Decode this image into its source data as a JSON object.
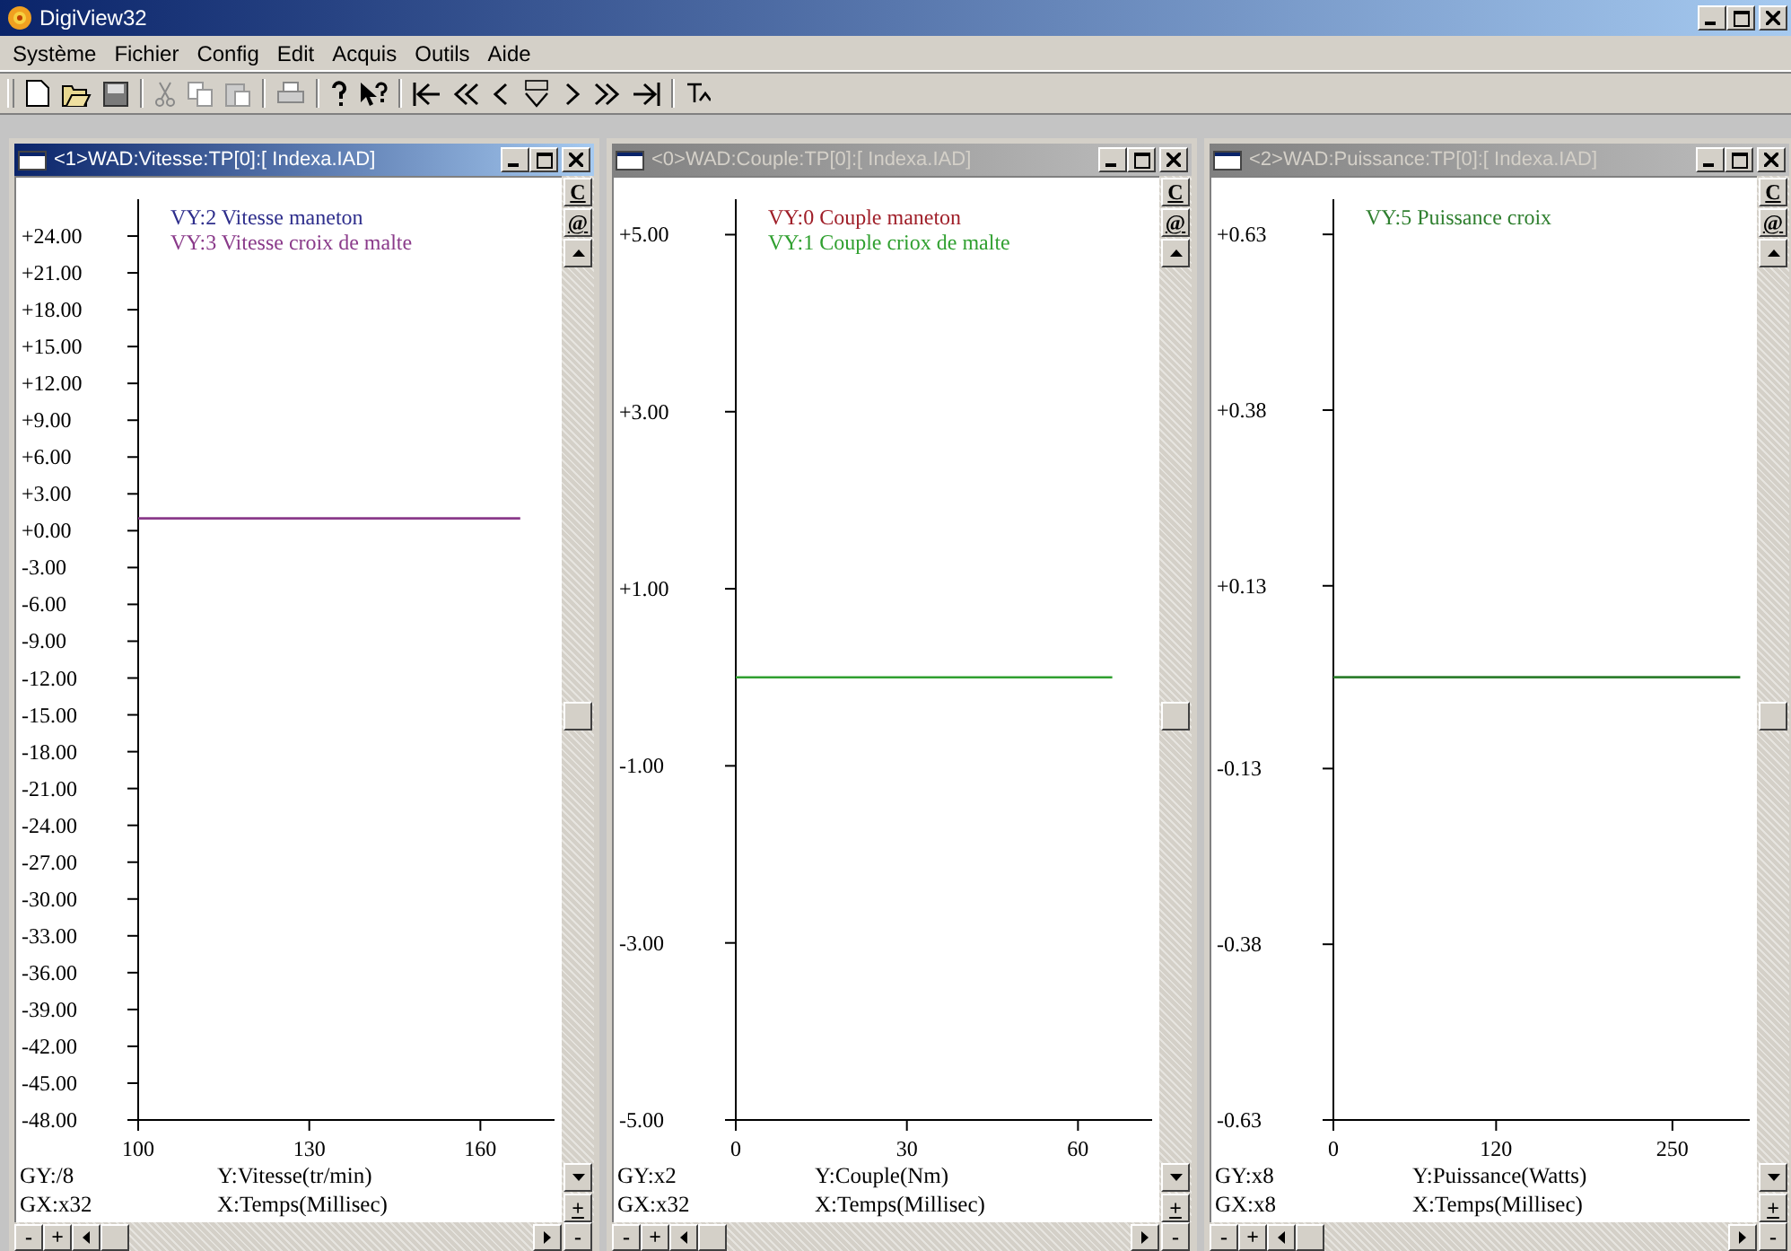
{
  "app": {
    "title": "DigiView32"
  },
  "menu": [
    "Système",
    "Fichier",
    "Config",
    "Edit",
    "Acquis",
    "Outils",
    "Aide"
  ],
  "windows": [
    {
      "title": "<1>WAD:Vitesse:TP[0]:[ Indexa.IAD]",
      "active": true,
      "side_buttons": [
        "C",
        "@"
      ],
      "zoom_v": [
        "+",
        "-"
      ],
      "zoom_h": [
        "-",
        "+"
      ],
      "gy": "GY:/8",
      "gx": "GX:x32",
      "chart_data": {
        "type": "line",
        "xlabel": "X:Temps(Millisec)",
        "ylabel": "Y:Vitesse(tr/min)",
        "x": [
          100,
          167
        ],
        "xlim": [
          100,
          173
        ],
        "ylim": [
          -48,
          27
        ],
        "xticks": [
          {
            "value": 100,
            "label": "100"
          },
          {
            "value": 130,
            "label": "130"
          },
          {
            "value": 160,
            "label": "160"
          }
        ],
        "yticks": [
          {
            "value": 24,
            "label": "+24.00"
          },
          {
            "value": 21,
            "label": "+21.00"
          },
          {
            "value": 18,
            "label": "+18.00"
          },
          {
            "value": 15,
            "label": "+15.00"
          },
          {
            "value": 12,
            "label": "+12.00"
          },
          {
            "value": 9,
            "label": "+9.00"
          },
          {
            "value": 6,
            "label": "+6.00"
          },
          {
            "value": 3,
            "label": "+3.00"
          },
          {
            "value": 0,
            "label": "+0.00"
          },
          {
            "value": -3,
            "label": "-3.00"
          },
          {
            "value": -6,
            "label": "-6.00"
          },
          {
            "value": -9,
            "label": "-9.00"
          },
          {
            "value": -12,
            "label": "-12.00"
          },
          {
            "value": -15,
            "label": "-15.00"
          },
          {
            "value": -18,
            "label": "-18.00"
          },
          {
            "value": -21,
            "label": "-21.00"
          },
          {
            "value": -24,
            "label": "-24.00"
          },
          {
            "value": -27,
            "label": "-27.00"
          },
          {
            "value": -30,
            "label": "-30.00"
          },
          {
            "value": -33,
            "label": "-33.00"
          },
          {
            "value": -36,
            "label": "-36.00"
          },
          {
            "value": -39,
            "label": "-39.00"
          },
          {
            "value": -42,
            "label": "-42.00"
          },
          {
            "value": -45,
            "label": "-45.00"
          },
          {
            "value": -48,
            "label": "-48.00"
          }
        ],
        "series": [
          {
            "name": "VY:2 Vitesse maneton",
            "color": "#2e2e8c",
            "values": [
              null,
              null
            ]
          },
          {
            "name": "VY:3 Vitesse croix de malte",
            "color": "#8a3a8a",
            "values": [
              1,
              1
            ]
          }
        ]
      }
    },
    {
      "title": "<0>WAD:Couple:TP[0]:[ Indexa.IAD]",
      "active": false,
      "side_buttons": [
        "C",
        "@"
      ],
      "zoom_v": [
        "+",
        "-"
      ],
      "zoom_h": [
        "-",
        "+"
      ],
      "gy": "GY:x2",
      "gx": "GX:x32",
      "chart_data": {
        "type": "line",
        "xlabel": "X:Temps(Millisec)",
        "ylabel": "Y:Couple(Nm)",
        "x": [
          0,
          66
        ],
        "xlim": [
          0,
          73
        ],
        "ylim": [
          -5,
          5.4
        ],
        "xticks": [
          {
            "value": 0,
            "label": "0"
          },
          {
            "value": 30,
            "label": "30"
          },
          {
            "value": 60,
            "label": "60"
          }
        ],
        "yticks": [
          {
            "value": 5,
            "label": "+5.00"
          },
          {
            "value": 3,
            "label": "+3.00"
          },
          {
            "value": 1,
            "label": "+1.00"
          },
          {
            "value": -1,
            "label": "-1.00"
          },
          {
            "value": -3,
            "label": "-3.00"
          },
          {
            "value": -5,
            "label": "-5.00"
          }
        ],
        "series": [
          {
            "name": "VY:0 Couple maneton",
            "color": "#a0202a",
            "values": [
              null,
              null
            ]
          },
          {
            "name": "VY:1 Couple criox de malte",
            "color": "#30a030",
            "values": [
              0,
              0
            ]
          }
        ]
      }
    },
    {
      "title": "<2>WAD:Puissance:TP[0]:[ Indexa.IAD]",
      "active": false,
      "side_buttons": [
        "C",
        "@"
      ],
      "zoom_v": [
        "+",
        "-"
      ],
      "zoom_h": [
        "-",
        "+"
      ],
      "gy": "GY:x8",
      "gx": "GX:x8",
      "chart_data": {
        "type": "line",
        "xlabel": "X:Temps(Millisec)",
        "ylabel": "Y:Puissance(Watts)",
        "x": [
          0,
          300
        ],
        "xlim": [
          0,
          307
        ],
        "ylim": [
          -0.63,
          0.68
        ],
        "xticks": [
          {
            "value": 0,
            "label": "0"
          },
          {
            "value": 120,
            "label": "120"
          },
          {
            "value": 250,
            "label": "250"
          }
        ],
        "yticks": [
          {
            "value": 0.63,
            "label": "+0.63"
          },
          {
            "value": 0.38,
            "label": "+0.38"
          },
          {
            "value": 0.13,
            "label": "+0.13"
          },
          {
            "value": -0.13,
            "label": "-0.13"
          },
          {
            "value": -0.38,
            "label": "-0.38"
          },
          {
            "value": -0.63,
            "label": "-0.63"
          }
        ],
        "series": [
          {
            "name": "VY:5 Puissance croix",
            "color": "#2f7f2f",
            "values": [
              0,
              0
            ]
          }
        ]
      }
    }
  ]
}
